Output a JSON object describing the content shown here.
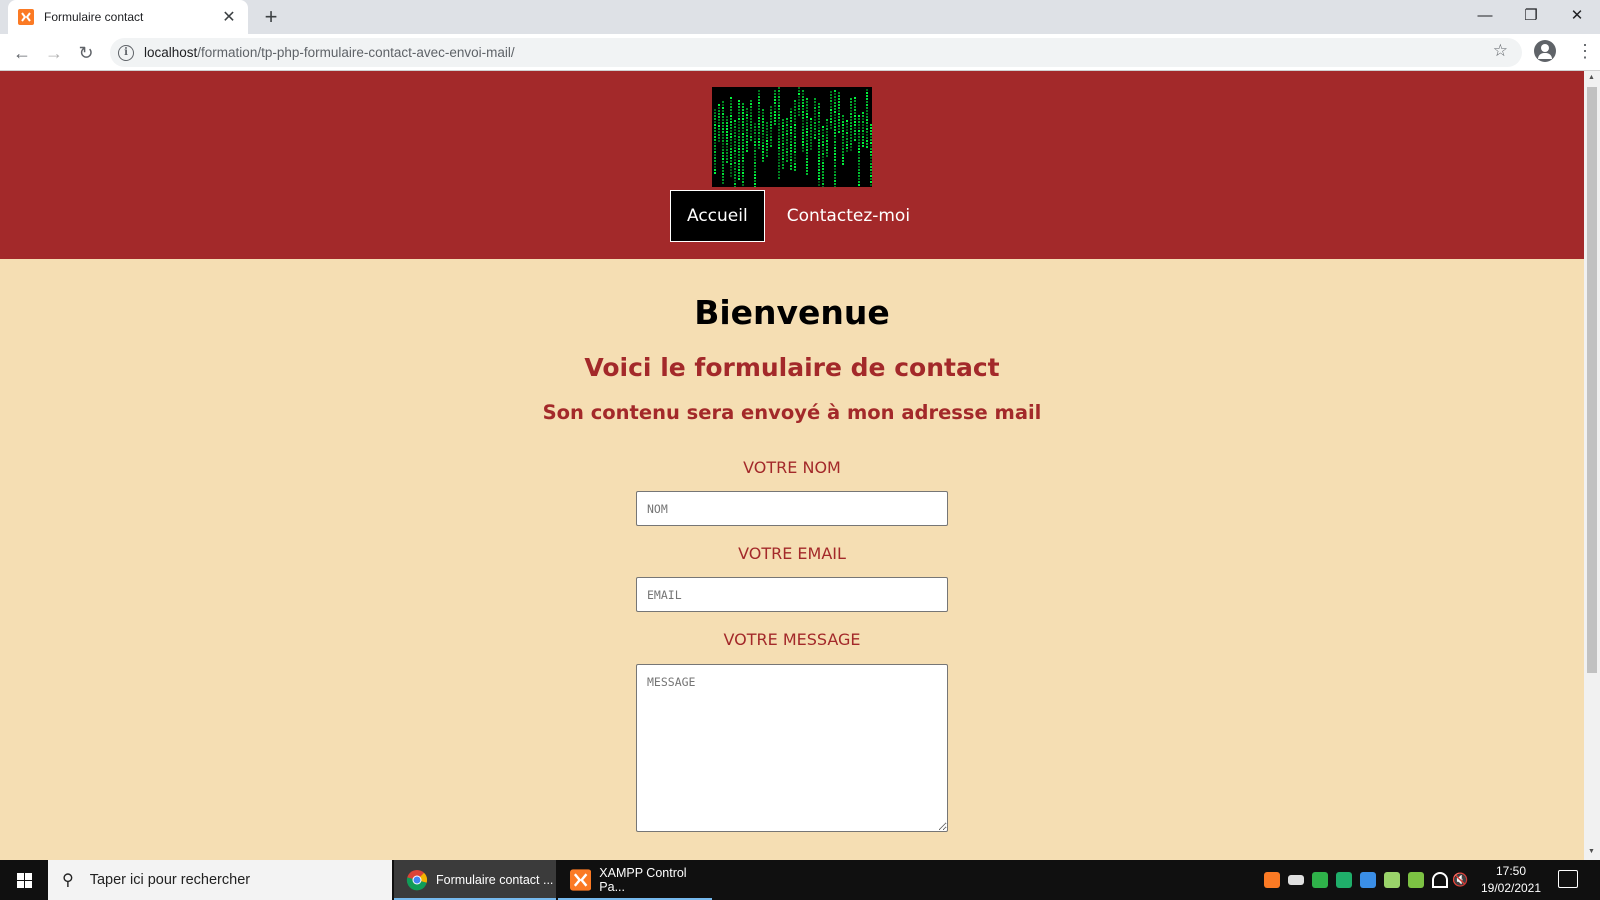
{
  "browser": {
    "tab_title": "Formulaire contact",
    "url_host": "localhost",
    "url_path": "/formation/tp-php-formulaire-contact-avec-envoi-mail/"
  },
  "site": {
    "nav": [
      {
        "label": "Accueil",
        "active": true
      },
      {
        "label": "Contactez-moi",
        "active": false
      }
    ],
    "title": "Bienvenue",
    "subtitle": "Voici le formulaire de contact",
    "subtitle2": "Son contenu sera envoyé à mon adresse mail",
    "form": {
      "name_label": "VOTRE NOM",
      "name_placeholder": "NOM",
      "email_label": "VOTRE EMAIL",
      "email_placeholder": "EMAIL",
      "message_label": "VOTRE MESSAGE",
      "message_placeholder": "MESSAGE"
    }
  },
  "taskbar": {
    "search_placeholder": "Taper ici pour rechercher",
    "items": [
      {
        "label": "Formulaire contact ...",
        "icon": "chrome-icon"
      },
      {
        "label": "XAMPP Control Pa...",
        "icon": "xampp-icon"
      }
    ],
    "time": "17:50",
    "date": "19/02/2021"
  },
  "colors": {
    "header_bg": "#a3292a",
    "page_bg": "#f5deb3",
    "accent_text": "#a3292a"
  }
}
